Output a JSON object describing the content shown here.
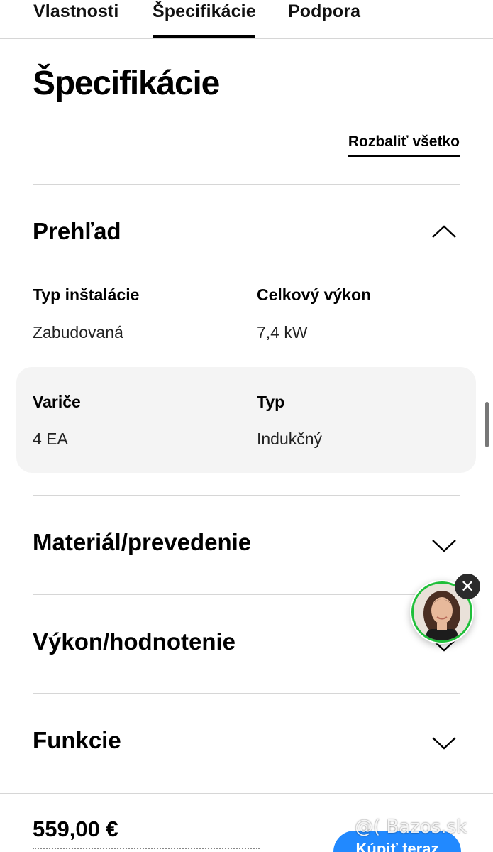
{
  "tabs": [
    {
      "label": "Vlastnosti",
      "active": false
    },
    {
      "label": "Špecifikácie",
      "active": true
    },
    {
      "label": "Podpora",
      "active": false
    }
  ],
  "page_title": "Špecifikácie",
  "expand_all_label": "Rozbaliť všetko",
  "sections": [
    {
      "title": "Prehľad",
      "expanded": true,
      "icon": "chevron-up-icon",
      "specs": [
        {
          "label": "Typ inštalácie",
          "value": "Zabudovaná"
        },
        {
          "label": "Celkový výkon",
          "value": "7,4 kW"
        },
        {
          "label": "Variče",
          "value": "4 EA"
        },
        {
          "label": "Typ",
          "value": "Indukčný"
        }
      ]
    },
    {
      "title": "Materiál/prevedenie",
      "expanded": false,
      "icon": "chevron-down-icon"
    },
    {
      "title": "Výkon/hodnotenie",
      "expanded": false,
      "icon": "chevron-down-icon"
    },
    {
      "title": "Funkcie",
      "expanded": false,
      "icon": "chevron-down-icon"
    }
  ],
  "chat": {
    "avatar": "agent-avatar",
    "close_glyph": "✕"
  },
  "bottom_bar": {
    "price": "559,00 €",
    "buy_label": "Kúpiť teraz",
    "watermark": "@( Bazos.sk"
  },
  "colors": {
    "accent": "#2189ff",
    "chat_ring": "#1fbf3a",
    "highlight_bg": "#f4f4f4",
    "divider": "#d6d6d6"
  }
}
